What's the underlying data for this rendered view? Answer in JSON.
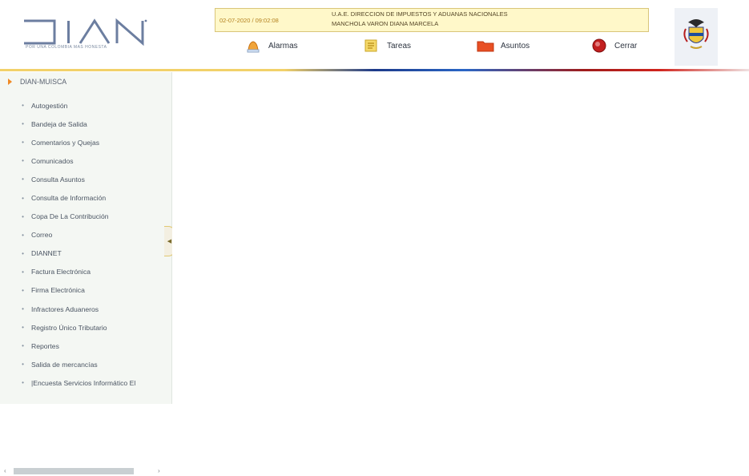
{
  "brand": {
    "logo_text": "DIAN",
    "tagline": "POR UNA COLOMBIA MAS HONESTA"
  },
  "session": {
    "datetime": "02-07-2020 / 09:02:08",
    "entity": "U.A.E. DIRECCION DE IMPUESTOS Y ADUANAS NACIONALES",
    "user": "MANCHOLA VARON DIANA MARCELA"
  },
  "toolbar": {
    "alarmas": "Alarmas",
    "tareas": "Tareas",
    "asuntos": "Asuntos",
    "cerrar": "Cerrar"
  },
  "icons": {
    "alarmas": "alarm-bell-icon",
    "tareas": "tasks-note-icon",
    "asuntos": "folder-icon",
    "cerrar": "close-circle-icon",
    "crest": "colombia-crest-icon",
    "root": "expand-arrow-icon"
  },
  "colors": {
    "accent": "#f08a25",
    "stripe_yellow": "#f2d16a",
    "stripe_blue": "#1d3a8a",
    "stripe_red": "#d0241d"
  },
  "sidebar": {
    "root": "DIAN-MUISCA",
    "items": [
      {
        "label": "Autogestión"
      },
      {
        "label": "Bandeja de Salida"
      },
      {
        "label": "Comentarios y Quejas"
      },
      {
        "label": "Comunicados"
      },
      {
        "label": "Consulta Asuntos"
      },
      {
        "label": "Consulta de Información"
      },
      {
        "label": "Copa De La Contribución"
      },
      {
        "label": "Correo"
      },
      {
        "label": "DIANNET"
      },
      {
        "label": "Factura Electrónica"
      },
      {
        "label": "Firma Electrónica"
      },
      {
        "label": "Infractores Aduaneros"
      },
      {
        "label": "Registro Único Tributario"
      },
      {
        "label": "Reportes"
      },
      {
        "label": "Salida de mercancías"
      },
      {
        "label": "|Encuesta Servicios Informático El"
      }
    ]
  }
}
